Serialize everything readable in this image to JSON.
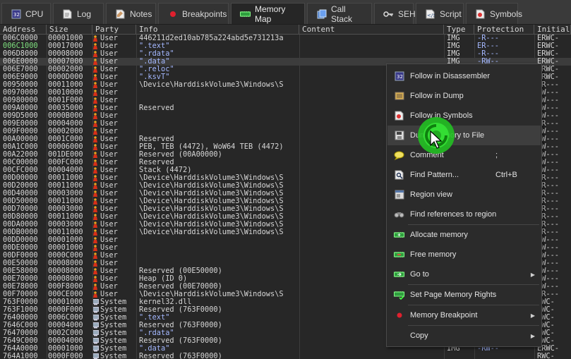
{
  "tabs": [
    {
      "label": "CPU",
      "icon": "cpu-icon"
    },
    {
      "label": "Log",
      "icon": "log-icon"
    },
    {
      "label": "Notes",
      "icon": "notes-icon"
    },
    {
      "label": "Breakpoints",
      "icon": "breakpoint-dot-icon"
    },
    {
      "label": "Memory Map",
      "icon": "memory-map-icon",
      "active": true
    },
    {
      "label": "Call Stack",
      "icon": "call-stack-icon"
    },
    {
      "label": "SEH",
      "icon": "seh-icon"
    },
    {
      "label": "Script",
      "icon": "script-icon"
    },
    {
      "label": "Symbols",
      "icon": "symbols-icon"
    }
  ],
  "columns": [
    "Address",
    "Size",
    "Party",
    "Info",
    "Content",
    "Type",
    "Protection",
    "Initial"
  ],
  "rows": [
    {
      "address": "006C0000",
      "size": "00001000",
      "party": "User",
      "info": "446211d2ed10ab785a224abd5e731213a",
      "content": "",
      "type": "IMG",
      "protection": "-R---",
      "initial": "ERWC-"
    },
    {
      "address": "006C1000",
      "size": "00017000",
      "party": "User",
      "info": " \".text\"",
      "content": "",
      "type": "IMG",
      "protection": "ER---",
      "initial": "ERWC-",
      "addr_color": "#7fe07f"
    },
    {
      "address": "006D8000",
      "size": "00008000",
      "party": "User",
      "info": " \".rdata\"",
      "content": "",
      "type": "IMG",
      "protection": "-R---",
      "initial": "ERWC-"
    },
    {
      "address": "006E0000",
      "size": "00007000",
      "party": "User",
      "info": " \".data\"",
      "content": "",
      "type": "IMG",
      "protection": "-RW--",
      "initial": "ERWC-",
      "selected": true
    },
    {
      "address": "006E7000",
      "size": "00002000",
      "party": "User",
      "info": " \".reloc\"",
      "content": "",
      "type": "",
      "protection": "",
      "initial": "ERWC-"
    },
    {
      "address": "006E9000",
      "size": "0000D000",
      "party": "User",
      "info": " \".ksvT\"",
      "content": "",
      "type": "",
      "protection": "",
      "initial": "ERWC-"
    },
    {
      "address": "00950000",
      "size": "00011000",
      "party": "User",
      "info": "\\Device\\HarddiskVolume3\\Windows\\S",
      "content": "",
      "type": "",
      "protection": "",
      "initial": "-R---"
    },
    {
      "address": "00970000",
      "size": "00010000",
      "party": "User",
      "info": "",
      "content": "",
      "type": "",
      "protection": "",
      "initial": "RW---"
    },
    {
      "address": "00980000",
      "size": "0001F000",
      "party": "User",
      "info": "",
      "content": "",
      "type": "",
      "protection": "",
      "initial": "RW---"
    },
    {
      "address": "009A0000",
      "size": "00035000",
      "party": "User",
      "info": "Reserved",
      "content": "",
      "type": "",
      "protection": "",
      "initial": "RW---"
    },
    {
      "address": "009D5000",
      "size": "0000B000",
      "party": "User",
      "info": "",
      "content": "",
      "type": "",
      "protection": "",
      "initial": "RW---"
    },
    {
      "address": "009E0000",
      "size": "00004000",
      "party": "User",
      "info": "",
      "content": "",
      "type": "",
      "protection": "",
      "initial": "-R---"
    },
    {
      "address": "009F0000",
      "size": "00002000",
      "party": "User",
      "info": "",
      "content": "",
      "type": "",
      "protection": "",
      "initial": "RW---"
    },
    {
      "address": "00A00000",
      "size": "0001C000",
      "party": "User",
      "info": "Reserved",
      "content": "",
      "type": "",
      "protection": "",
      "initial": "RW---"
    },
    {
      "address": "00A1C000",
      "size": "00006000",
      "party": "User",
      "info": "PEB, TEB (4472), WoW64 TEB (4472)",
      "content": "",
      "type": "",
      "protection": "",
      "initial": "RW---"
    },
    {
      "address": "00A22000",
      "size": "001DE000",
      "party": "User",
      "info": "Reserved (00A00000)",
      "content": "",
      "type": "",
      "protection": "",
      "initial": "RW---"
    },
    {
      "address": "00C00000",
      "size": "000FC000",
      "party": "User",
      "info": "Reserved",
      "content": "",
      "type": "",
      "protection": "",
      "initial": "RW---"
    },
    {
      "address": "00CFC000",
      "size": "00004000",
      "party": "User",
      "info": "Stack (4472)",
      "content": "",
      "type": "",
      "protection": "",
      "initial": "RW---"
    },
    {
      "address": "00D00000",
      "size": "00011000",
      "party": "User",
      "info": "\\Device\\HarddiskVolume3\\Windows\\S",
      "content": "",
      "type": "",
      "protection": "",
      "initial": "-R---"
    },
    {
      "address": "00D20000",
      "size": "00011000",
      "party": "User",
      "info": "\\Device\\HarddiskVolume3\\Windows\\S",
      "content": "",
      "type": "",
      "protection": "",
      "initial": "-R---"
    },
    {
      "address": "00D40000",
      "size": "00003000",
      "party": "User",
      "info": "\\Device\\HarddiskVolume3\\Windows\\S",
      "content": "",
      "type": "",
      "protection": "",
      "initial": "-R---"
    },
    {
      "address": "00D50000",
      "size": "00011000",
      "party": "User",
      "info": "\\Device\\HarddiskVolume3\\Windows\\S",
      "content": "",
      "type": "",
      "protection": "",
      "initial": "-R---"
    },
    {
      "address": "00D70000",
      "size": "00003000",
      "party": "User",
      "info": "\\Device\\HarddiskVolume3\\Windows\\S",
      "content": "",
      "type": "",
      "protection": "",
      "initial": "-R---"
    },
    {
      "address": "00D80000",
      "size": "00011000",
      "party": "User",
      "info": "\\Device\\HarddiskVolume3\\Windows\\S",
      "content": "",
      "type": "",
      "protection": "",
      "initial": "-R---"
    },
    {
      "address": "00DA0000",
      "size": "00003000",
      "party": "User",
      "info": "\\Device\\HarddiskVolume3\\Windows\\S",
      "content": "",
      "type": "",
      "protection": "",
      "initial": "-R---"
    },
    {
      "address": "00DB0000",
      "size": "00011000",
      "party": "User",
      "info": "\\Device\\HarddiskVolume3\\Windows\\S",
      "content": "",
      "type": "",
      "protection": "",
      "initial": "-R---"
    },
    {
      "address": "00DD0000",
      "size": "00001000",
      "party": "User",
      "info": "",
      "content": "",
      "type": "",
      "protection": "",
      "initial": "RW---"
    },
    {
      "address": "00DE0000",
      "size": "00001000",
      "party": "User",
      "info": "",
      "content": "",
      "type": "",
      "protection": "",
      "initial": "RW---"
    },
    {
      "address": "00DF0000",
      "size": "0000C000",
      "party": "User",
      "info": "",
      "content": "",
      "type": "",
      "protection": "",
      "initial": "RW---"
    },
    {
      "address": "00E50000",
      "size": "00008000",
      "party": "User",
      "info": "",
      "content": "",
      "type": "",
      "protection": "",
      "initial": "RW---"
    },
    {
      "address": "00E58000",
      "size": "00008000",
      "party": "User",
      "info": "Reserved (00E50000)",
      "content": "",
      "type": "",
      "protection": "",
      "initial": "RW---"
    },
    {
      "address": "00E70000",
      "size": "00008000",
      "party": "User",
      "info": "Heap (ID 0)",
      "content": "",
      "type": "",
      "protection": "",
      "initial": "RW---"
    },
    {
      "address": "00E78000",
      "size": "000F8000",
      "party": "User",
      "info": "Reserved (00E70000)",
      "content": "",
      "type": "",
      "protection": "",
      "initial": "RW---"
    },
    {
      "address": "00F70000",
      "size": "000CE000",
      "party": "User",
      "info": "\\Device\\HarddiskVolume3\\Windows\\S",
      "content": "",
      "type": "",
      "protection": "",
      "initial": "-R---"
    },
    {
      "address": "763F0000",
      "size": "00001000",
      "party": "System",
      "info": "kernel32.dll",
      "content": "",
      "type": "",
      "protection": "",
      "initial": "RWC-"
    },
    {
      "address": "763F1000",
      "size": "0000F000",
      "party": "System",
      "info": "Reserved (763F0000)",
      "content": "",
      "type": "",
      "protection": "",
      "initial": "RWC-"
    },
    {
      "address": "76400000",
      "size": "0006C000",
      "party": "System",
      "info": " \".text\"",
      "content": "",
      "type": "",
      "protection": "",
      "initial": "RWC-"
    },
    {
      "address": "7646C000",
      "size": "00004000",
      "party": "System",
      "info": "Reserved (763F0000)",
      "content": "",
      "type": "",
      "protection": "",
      "initial": "RWC-"
    },
    {
      "address": "76470000",
      "size": "0002C000",
      "party": "System",
      "info": " \".rdata\"",
      "content": "",
      "type": "",
      "protection": "",
      "initial": "RWC-"
    },
    {
      "address": "7649C000",
      "size": "00004000",
      "party": "System",
      "info": "Reserved (763F0000)",
      "content": "",
      "type": "",
      "protection": "",
      "initial": "RWC-"
    },
    {
      "address": "764A0000",
      "size": "00001000",
      "party": "System",
      "info": " \".data\"",
      "content": "",
      "type": "IMG",
      "protection": "-RW--",
      "initial": "ERWC-"
    },
    {
      "address": "764A1000",
      "size": "0000F000",
      "party": "System",
      "info": "Reserved (763F0000)",
      "content": "",
      "type": "",
      "protection": "",
      "initial": "RWC-"
    }
  ],
  "context_menu": {
    "items": [
      {
        "label": "Follow in Disassembler",
        "icon": "disassembler-icon"
      },
      {
        "label": "Follow in Dump",
        "icon": "dump-icon"
      },
      {
        "label": "Follow in Symbols",
        "icon": "symbols-icon"
      },
      {
        "label": "Dump Memory to File",
        "icon": "save-memory-icon",
        "highlighted": true
      },
      {
        "label": "Comment",
        "icon": "comment-icon",
        "shortcut": ";"
      },
      {
        "label": "Find Pattern...",
        "icon": "find-pattern-icon",
        "shortcut": "Ctrl+B"
      },
      {
        "label": "Region view",
        "icon": "region-view-icon"
      },
      {
        "label": "Find references to region",
        "icon": "binoculars-icon"
      },
      {
        "label": "Allocate memory",
        "icon": "allocate-memory-icon",
        "separator_before": true
      },
      {
        "label": "Free memory",
        "icon": "free-memory-icon"
      },
      {
        "label": "Go to",
        "icon": "goto-icon",
        "submenu": true
      },
      {
        "label": "Set Page Memory Rights",
        "icon": "page-rights-icon",
        "separator_before": true
      },
      {
        "label": "Memory Breakpoint",
        "icon": "memory-breakpoint-icon",
        "submenu": true,
        "separator_before": true
      },
      {
        "label": "Copy",
        "icon": "copy-icon",
        "submenu": true,
        "separator_before": true
      }
    ]
  },
  "colors": {
    "background": "#272727",
    "text": "#d6d6d6",
    "string_text": "#a4b8ff",
    "eip_address": "#7fe07f",
    "click_indicator": "#2ecc2e"
  }
}
